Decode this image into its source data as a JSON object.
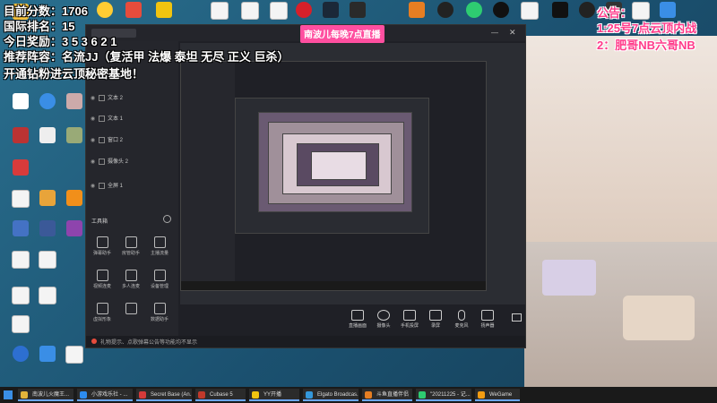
{
  "overlay": {
    "stats": [
      "目前分数：1706",
      "国际排名：15",
      "今日奖励：3 5 3 6 2 1",
      "推荐阵容：名流JJ（复活甲 法爆 泰坦 无尽 正义 巨杀）",
      "开通钻粉进云顶秘密基地！"
    ],
    "banner": "南波儿每晚7点直播",
    "notice": [
      "公告：",
      "1:25号7点云顶内战",
      "2：肥哥NB六哥NB"
    ]
  },
  "desktop_icons_left": [
    {
      "label": "",
      "color": "#f6c23e"
    },
    {
      "label": "",
      "color": "#3a8ee6"
    },
    {
      "label": "",
      "color": "#ffffff"
    },
    {
      "label": "",
      "color": "#e04848"
    },
    {
      "label": "",
      "color": "#dcdcdc"
    },
    {
      "label": "",
      "color": "#d83b3b"
    },
    {
      "label": "",
      "color": "#f4f4f4"
    },
    {
      "label": "",
      "color": "#4472c4"
    },
    {
      "label": "",
      "color": "#f4f4f4"
    }
  ],
  "app": {
    "title": "",
    "scenes": [
      "文本 2",
      "文本 1",
      "窗口 2",
      "摄像头 2",
      "全屏 1"
    ],
    "tools_title": "工具箱",
    "tools": [
      "弹幕助手",
      "房管助手",
      "主播流量",
      "视频连麦",
      "多人连麦",
      "设备管理",
      "虚拟形象",
      "",
      "数据助手"
    ],
    "bottom_buttons": [
      "直播画面",
      "摄像头",
      "手机投屏",
      "录屏",
      "麦克风",
      "扬声器"
    ],
    "status_text": "礼物提示、点歌弹幕公告等功能均不显示"
  },
  "taskbar": {
    "items": [
      {
        "label": "南波儿火魔王...",
        "color": "#e2b33a"
      },
      {
        "label": "小游戏乐社 - ...",
        "color": "#2d8cf0"
      },
      {
        "label": "Secret Base (An...",
        "color": "#d43a3a"
      },
      {
        "label": "Cubase 5",
        "color": "#c0392b"
      },
      {
        "label": "YY开播",
        "color": "#f1c40f"
      },
      {
        "label": "Elgato Broadcas...",
        "color": "#3498db"
      },
      {
        "label": "斗鱼直播伴侣",
        "color": "#e67e22"
      },
      {
        "label": "\"20211225 - 记...",
        "color": "#2ecc71"
      },
      {
        "label": "WeGame",
        "color": "#f39c12"
      }
    ]
  }
}
